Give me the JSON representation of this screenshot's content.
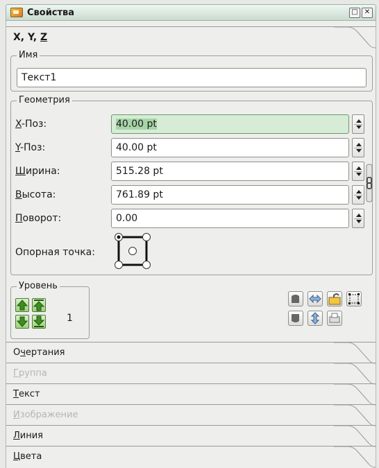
{
  "window": {
    "title": "Свойства",
    "btn_minimize": "□",
    "btn_close": "✕"
  },
  "header": {
    "xyz_x": "X, Y, ",
    "xyz_z": "Z"
  },
  "name_group": {
    "legend": "Имя",
    "value": "Текст1"
  },
  "geometry": {
    "legend": "Геометрия",
    "rows": [
      {
        "key": "X",
        "rest": "-Поз:",
        "value": "40.00 pt"
      },
      {
        "key": "Y",
        "rest": "-Поз:",
        "value": "40.00 pt"
      },
      {
        "key": "Ш",
        "rest": "ирина:",
        "value": "515.28 pt"
      },
      {
        "key": "В",
        "rest": "ысота:",
        "value": "761.89 pt"
      },
      {
        "key": "П",
        "rest": "оворот:",
        "value": "0.00"
      }
    ],
    "anchor_label": "Опорная точка:"
  },
  "level": {
    "legend": "Уровень",
    "value": "1"
  },
  "sections": [
    {
      "pre": "О",
      "key": "ч",
      "post": "ертания",
      "enabled": true
    },
    {
      "pre": "",
      "key": "Г",
      "post": "руппа",
      "enabled": false
    },
    {
      "pre": "",
      "key": "Т",
      "post": "екст",
      "enabled": true
    },
    {
      "pre": "",
      "key": "И",
      "post": "зображение",
      "enabled": false
    },
    {
      "pre": "",
      "key": "Л",
      "post": "иния",
      "enabled": true
    },
    {
      "pre": "",
      "key": "Ц",
      "post": "вета",
      "enabled": true
    }
  ],
  "colors": {
    "titlebar": "#c9dccf",
    "focused_field": "#d6ecd6",
    "arrow_green": "#6cb040"
  }
}
